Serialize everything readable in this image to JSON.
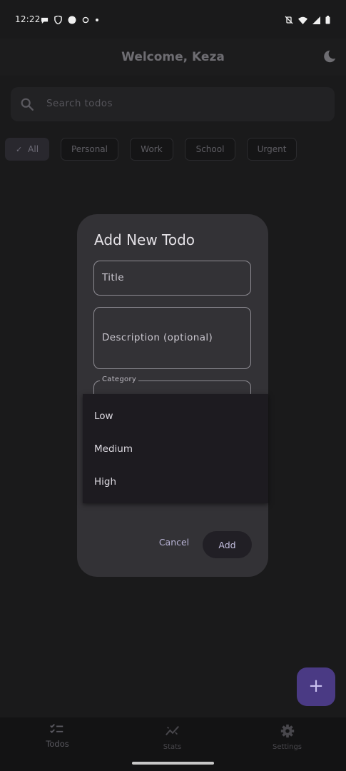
{
  "status_bar": {
    "time": "12:22",
    "left_icons": [
      "chat-bubble-icon",
      "shield-app-icon",
      "circle-filled-icon",
      "circle-outline-icon",
      "dot-icon"
    ],
    "right_icons": [
      "vibrate-mute-icon",
      "wifi-icon",
      "cell-signal-icon",
      "battery-icon"
    ]
  },
  "header": {
    "title": "Welcome, Keza",
    "theme_icon": "moon-icon"
  },
  "search": {
    "placeholder": "Search todos",
    "icon": "search-icon"
  },
  "filters": {
    "selected": "All",
    "chips": [
      {
        "label": "All"
      },
      {
        "label": "Personal"
      },
      {
        "label": "Work"
      },
      {
        "label": "School"
      },
      {
        "label": "Urgent"
      }
    ]
  },
  "dialog": {
    "title": "Add New Todo",
    "title_placeholder": "Title",
    "description_placeholder": "Description (optional)",
    "category_label": "Category",
    "priority_options": [
      {
        "label": "Low"
      },
      {
        "label": "Medium"
      },
      {
        "label": "High"
      }
    ],
    "cancel_label": "Cancel",
    "add_label": "Add"
  },
  "fab": {
    "icon": "plus-icon",
    "glyph": "+"
  },
  "bottom_nav": {
    "items": [
      {
        "label": "Todos",
        "icon": "checklist-icon",
        "active": true
      },
      {
        "label": "Stats",
        "icon": "trending-chart-icon",
        "active": false
      },
      {
        "label": "Settings",
        "icon": "gear-icon",
        "active": false
      }
    ]
  },
  "colors": {
    "background": "#1a1a1b",
    "dialog": "#333236",
    "menu": "#1d1b20",
    "accent": "#4a3a84",
    "button_text": "#b9b4d6"
  }
}
